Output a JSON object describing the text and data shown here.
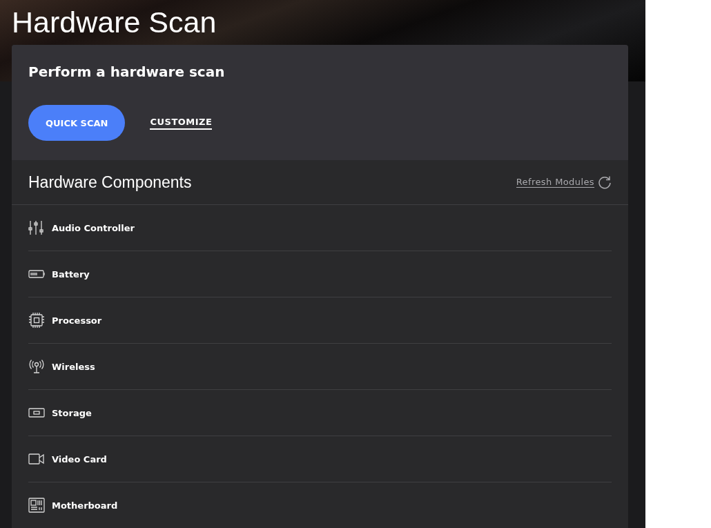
{
  "page_title": "Hardware Scan",
  "scan_card": {
    "title": "Perform a hardware scan",
    "buttons": [
      {
        "kind": "primary",
        "label": "QUICK SCAN"
      },
      {
        "kind": "link",
        "label": "CUSTOMIZE"
      }
    ]
  },
  "components": {
    "title": "Hardware Components",
    "refresh_label": "Refresh Modules",
    "items": [
      {
        "kind": "audio",
        "label": "Audio Controller"
      },
      {
        "kind": "battery",
        "label": "Battery"
      },
      {
        "kind": "processor",
        "label": "Processor"
      },
      {
        "kind": "wireless",
        "label": "Wireless"
      },
      {
        "kind": "storage",
        "label": "Storage"
      },
      {
        "kind": "video",
        "label": "Video Card"
      },
      {
        "kind": "motherboard",
        "label": "Motherboard"
      }
    ]
  }
}
